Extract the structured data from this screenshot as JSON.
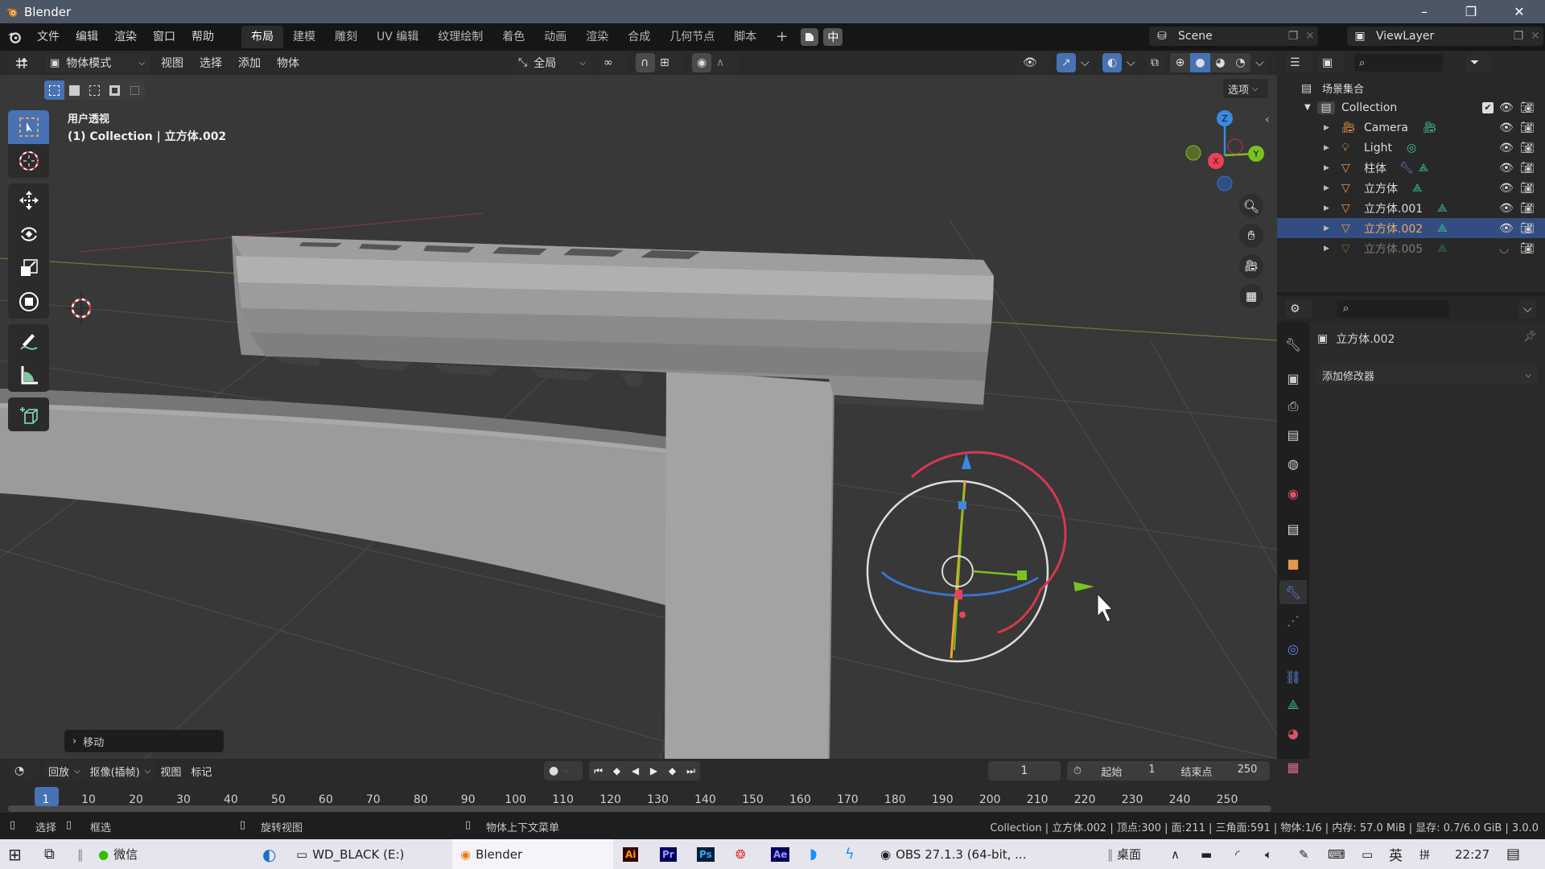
{
  "window": {
    "title": "Blender",
    "minimize": "–",
    "maximize": "❐",
    "close": "✕"
  },
  "menu": [
    "文件",
    "编辑",
    "渲染",
    "窗口",
    "帮助"
  ],
  "workspaces": [
    "布局",
    "建模",
    "雕刻",
    "UV 编辑",
    "纹理绘制",
    "着色",
    "动画",
    "渲染",
    "合成",
    "几何节点",
    "脚本"
  ],
  "workspace_add": "+",
  "ime_label": "中",
  "scene": {
    "name": "Scene",
    "view_layer": "ViewLayer"
  },
  "viewport_header": {
    "mode": "物体模式",
    "menus": [
      "视图",
      "选择",
      "添加",
      "物体"
    ],
    "transform_orientation": "全局",
    "options": "选项"
  },
  "viewport": {
    "view_name": "用户透视",
    "object_info": "(1) Collection | 立方体.002",
    "last_operator": "移动",
    "gizmo_axes": {
      "x": "X",
      "y": "Y",
      "z": "Z"
    },
    "colors": {
      "x": "#e8415a",
      "y": "#7ac21e",
      "z": "#3a8ae0",
      "selection": "#4772b3"
    }
  },
  "outliner": {
    "root": "场景集合",
    "collection": "Collection",
    "items": [
      {
        "name": "Camera",
        "type": "camera"
      },
      {
        "name": "Light",
        "type": "light"
      },
      {
        "name": "柱体",
        "type": "mesh",
        "modifier": true
      },
      {
        "name": "立方体",
        "type": "mesh"
      },
      {
        "name": "立方体.001",
        "type": "mesh"
      },
      {
        "name": "立方体.002",
        "type": "mesh",
        "selected": true
      },
      {
        "name": "立方体.005",
        "type": "mesh",
        "hidden": true
      }
    ]
  },
  "properties": {
    "object_name": "立方体.002",
    "add_modifier": "添加修改器",
    "tabs": [
      "tool",
      "render",
      "output",
      "view-layer",
      "scene",
      "world",
      "collection",
      "object",
      "modifiers",
      "particles",
      "physics",
      "constraints",
      "data",
      "material",
      "texture"
    ],
    "active_tab": "modifiers"
  },
  "timeline": {
    "menus": [
      "回放",
      "抠像(插帧)",
      "视图",
      "标记"
    ],
    "current_frame": "1",
    "start_label": "起始",
    "start": "1",
    "end_label": "结束点",
    "end": "250",
    "ticks": [
      "1",
      "10",
      "20",
      "30",
      "40",
      "50",
      "60",
      "70",
      "80",
      "90",
      "100",
      "110",
      "120",
      "130",
      "140",
      "150",
      "160",
      "170",
      "180",
      "190",
      "200",
      "210",
      "220",
      "230",
      "240",
      "250"
    ]
  },
  "statusbar": {
    "select": "选择",
    "box_select": "框选",
    "rotate_view": "旋转视图",
    "context_menu": "物体上下文菜单",
    "stats": "Collection | 立方体.002 | 顶点:300 | 面:211 | 三角面:591 | 物体:1/6 | 内存: 57.0 MiB | 显存: 0.7/6.0 GiB | 3.0.0"
  },
  "taskbar": {
    "apps": [
      {
        "label": "微信"
      },
      {
        "label": "WD_BLACK (E:)"
      },
      {
        "label": "Blender"
      },
      {
        "label": "OBS 27.1.3 (64-bit, ..."
      }
    ],
    "pinned": [
      "Ai",
      "Pr",
      "Ps",
      "Ae"
    ],
    "desktop": "桌面",
    "lang": "英",
    "ime": "拼",
    "time": "22:27"
  }
}
